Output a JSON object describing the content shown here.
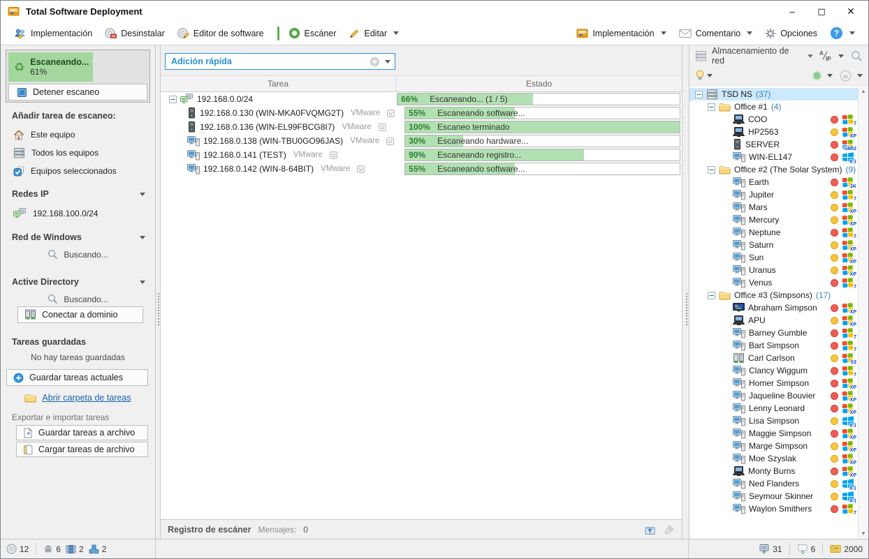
{
  "window": {
    "title": "Total Software Deployment",
    "minimize": "–",
    "maximize": "◻",
    "close": "✕"
  },
  "toolbar": {
    "left": [
      {
        "label": "Implementación"
      },
      {
        "label": "Desinstalar"
      },
      {
        "label": "Editor de software"
      },
      {
        "label": "Escáner"
      },
      {
        "label": "Editar"
      }
    ],
    "right": [
      {
        "label": "Implementación"
      },
      {
        "label": "Comentario"
      },
      {
        "label": "Opciones"
      },
      {
        "label": "?"
      }
    ]
  },
  "sidebar": {
    "scan_progress": {
      "label": "Escaneando...",
      "percent": "61%",
      "percent_value": 61
    },
    "stop_button": "Detener escaneo",
    "add_task_header": "Añadir tarea de escaneo:",
    "add_task_items": [
      {
        "label": "Este equipo"
      },
      {
        "label": "Todos los equipos"
      },
      {
        "label": "Equipos seleccionados"
      }
    ],
    "redes_ip": {
      "header": "Redes IP",
      "item": "192.168.100.0/24"
    },
    "red_windows": {
      "header": "Red de Windows",
      "status": "Buscando..."
    },
    "active_directory": {
      "header": "Active Directory",
      "status": "Buscando...",
      "connect_button": "Conectar a dominio"
    },
    "saved_tasks": {
      "header": "Tareas guardadas",
      "empty_text": "No hay tareas guardadas",
      "save_button": "Guardar tareas actuales",
      "open_link": "Abrir carpeta de tareas",
      "export_label": "Exportar e importar tareas",
      "save_file_button": "Guardar tareas a archivo",
      "load_file_button": "Cargar tareas de archivo"
    }
  },
  "main": {
    "quick_add": {
      "label": "Adición rápida"
    },
    "table": {
      "columns": [
        "Tarea",
        "Estado"
      ],
      "rows": [
        {
          "level": 0,
          "icon": "network",
          "name": "192.168.0.0/24",
          "vm": "",
          "percent": "66%",
          "status": "Escaneando... (1 / 5)",
          "fill": 48
        },
        {
          "level": 1,
          "icon": "tower",
          "name": "192.168.0.130 (WIN-MKA0FVQMG2T)",
          "vm": "VMware",
          "percent": "55%",
          "status": "Escaneando software...",
          "fill": 40
        },
        {
          "level": 1,
          "icon": "tower",
          "name": "192.168.0.136 (WIN-EL99FBCG8I7)",
          "vm": "VMware",
          "percent": "100%",
          "status": "Escaneo terminado",
          "fill": 100
        },
        {
          "level": 1,
          "icon": "desktop",
          "name": "192.168.0.138 (WIN-TBU0GO96JAS)",
          "vm": "VMware",
          "percent": "30%",
          "status": "Escaneando hardware...",
          "fill": 21
        },
        {
          "level": 1,
          "icon": "desktop",
          "name": "192.168.0.141 (TEST)",
          "vm": "VMware",
          "percent": "90%",
          "status": "Escaneando registro...",
          "fill": 65
        },
        {
          "level": 1,
          "icon": "desktop",
          "name": "192.168.0.142 (WIN-8-64BIT)",
          "vm": "VMware",
          "percent": "55%",
          "status": "Escaneando software...",
          "fill": 40
        }
      ]
    },
    "log_bar": {
      "title": "Registro de escáner",
      "messages_label": "Mensajes:",
      "messages_count": "0"
    }
  },
  "right_panel": {
    "header": {
      "title": "Almacenamiento de red",
      "sort_icon_label": "A/IP",
      "os_circle_label": "os"
    },
    "tree": {
      "root": {
        "name": "TSD NS",
        "count": "(37)"
      },
      "groups": [
        {
          "name": "Office #1",
          "count": "(4)",
          "items": [
            {
              "name": "COO",
              "device": "laptop",
              "dot": "red",
              "os": "7"
            },
            {
              "name": "HP2563",
              "device": "laptop",
              "dot": "yellow",
              "os": "XP"
            },
            {
              "name": "SERVER",
              "device": "tower",
              "dot": "red",
              "os": "S8R2"
            },
            {
              "name": "WIN-EL147",
              "device": "desktop",
              "dot": "red",
              "os": "8.1"
            }
          ]
        },
        {
          "name": "Office #2 (The Solar System)",
          "count": "(9)",
          "items": [
            {
              "name": "Earth",
              "device": "desktop",
              "dot": "red",
              "os": "2K"
            },
            {
              "name": "Jupiter",
              "device": "desktop",
              "dot": "yellow",
              "os": "7"
            },
            {
              "name": "Mars",
              "device": "desktop",
              "dot": "yellow",
              "os": "XP"
            },
            {
              "name": "Mercury",
              "device": "desktop",
              "dot": "yellow",
              "os": "XP"
            },
            {
              "name": "Neptune",
              "device": "desktop",
              "dot": "red",
              "os": "7"
            },
            {
              "name": "Saturn",
              "device": "desktop",
              "dot": "yellow",
              "os": "XP"
            },
            {
              "name": "Sun",
              "device": "desktop",
              "dot": "yellow",
              "os": "XP"
            },
            {
              "name": "Uranus",
              "device": "desktop",
              "dot": "yellow",
              "os": "XP"
            },
            {
              "name": "Venus",
              "device": "desktop",
              "dot": "red",
              "os": "7"
            }
          ]
        },
        {
          "name": "Office #3 (Simpsons)",
          "count": "(17)",
          "items": [
            {
              "name": "Abraham Simpson",
              "device": "media",
              "dot": "red",
              "os": "XP"
            },
            {
              "name": "APU",
              "device": "laptop",
              "dot": "yellow",
              "os": "XP"
            },
            {
              "name": "Barney Gumble",
              "device": "desktop",
              "dot": "red",
              "os": "7"
            },
            {
              "name": "Bart Simpson",
              "device": "desktop",
              "dot": "red",
              "os": "7"
            },
            {
              "name": "Carl Carlson",
              "device": "domain",
              "dot": "yellow",
              "os": "S3"
            },
            {
              "name": "Clancy Wiggum",
              "device": "desktop",
              "dot": "red",
              "os": "7"
            },
            {
              "name": "Homer Simpson",
              "device": "desktop",
              "dot": "red",
              "os": "XP"
            },
            {
              "name": "Jaqueline Bouvier",
              "device": "desktop",
              "dot": "red",
              "os": "XP"
            },
            {
              "name": "Lenny Leonard",
              "device": "desktop",
              "dot": "red",
              "os": "XP"
            },
            {
              "name": "Lisa Simpson",
              "device": "desktop",
              "dot": "yellow",
              "os": "8.1"
            },
            {
              "name": "Maggie Simpson",
              "device": "desktop",
              "dot": "red",
              "os": "XP"
            },
            {
              "name": "Marge Simpson",
              "device": "desktop",
              "dot": "yellow",
              "os": "XP"
            },
            {
              "name": "Moe Szyslak",
              "device": "desktop",
              "dot": "yellow",
              "os": "XP"
            },
            {
              "name": "Monty Burns",
              "device": "laptop",
              "dot": "red",
              "os": "XP"
            },
            {
              "name": "Ned Flanders",
              "device": "desktop",
              "dot": "yellow",
              "os": "8.1"
            },
            {
              "name": "Seymour Skinner",
              "device": "desktop",
              "dot": "yellow",
              "os": "8.1"
            },
            {
              "name": "Waylon Smithers",
              "device": "desktop",
              "dot": "red",
              "os": "7"
            }
          ]
        }
      ]
    }
  },
  "status_bar": {
    "left": [
      {
        "icon": "disc-icon",
        "value": "12"
      },
      {
        "icon": "ghost-icon",
        "value": "6"
      },
      {
        "icon": "package-icon",
        "value": "2"
      },
      {
        "icon": "blocks-icon",
        "value": "2"
      }
    ],
    "right": [
      {
        "icon": "computer-icon",
        "value": "31"
      },
      {
        "icon": "selection-icon",
        "value": "6"
      },
      {
        "icon": "license-key-icon",
        "value": "2000"
      }
    ]
  },
  "colors": {
    "accent_blue": "#2b8fd0",
    "progress_green": "#b2e0b2",
    "scan_green": "#a3d79e",
    "selected_row": "#cde9fb",
    "status_red": "#f05c56",
    "status_yellow": "#f7c53d",
    "link_blue": "#1764b4"
  }
}
